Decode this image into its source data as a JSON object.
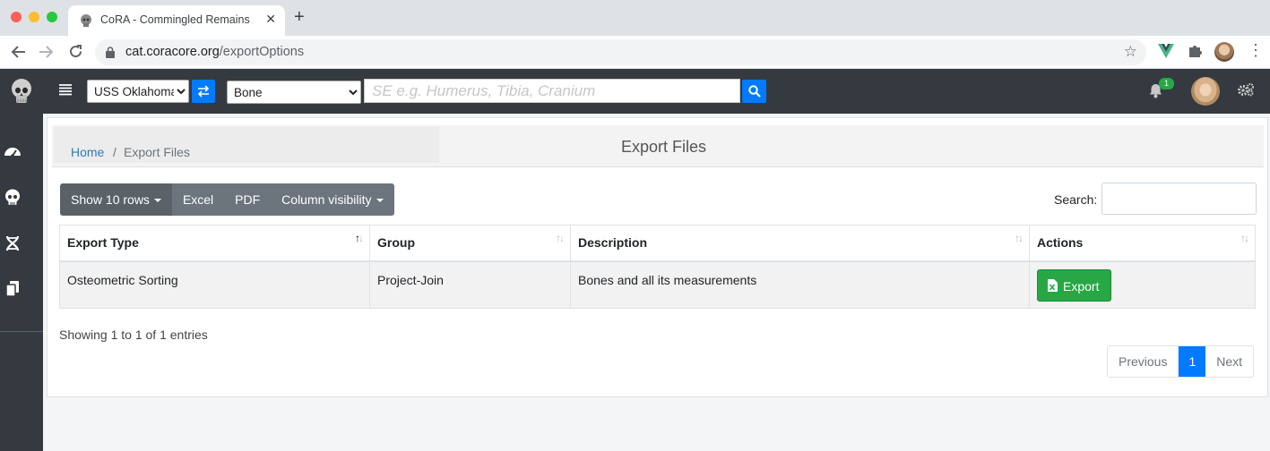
{
  "browser": {
    "tab_title": "CoRA - Commingled Remains A",
    "tab_close": "✕",
    "new_tab": "+",
    "url_host": "cat.coracore.org",
    "url_path": "/exportOptions"
  },
  "navbar": {
    "project_select": "USS Oklahoma",
    "bone_select": "Bone",
    "search_placeholder": "SE e.g. Humerus, Tibia, Cranium",
    "notification_count": "1"
  },
  "breadcrumb": {
    "home": "Home",
    "separator": "/",
    "current": "Export Files"
  },
  "page_title": "Export Files",
  "toolbar": {
    "show_rows": "Show 10 rows",
    "excel": "Excel",
    "pdf": "PDF",
    "column_visibility": "Column visibility",
    "search_label": "Search:"
  },
  "table": {
    "columns": [
      "Export Type",
      "Group",
      "Description",
      "Actions"
    ],
    "rows": [
      {
        "export_type": "Osteometric Sorting",
        "group": "Project-Join",
        "description": "Bones and all its measurements",
        "action_label": "Export"
      }
    ]
  },
  "footer": {
    "info": "Showing 1 to 1 of 1 entries",
    "previous": "Previous",
    "page": "1",
    "next": "Next"
  },
  "colors": {
    "primary": "#007bff",
    "success": "#28a745",
    "secondary": "#6c757d",
    "dark": "#343a40"
  }
}
